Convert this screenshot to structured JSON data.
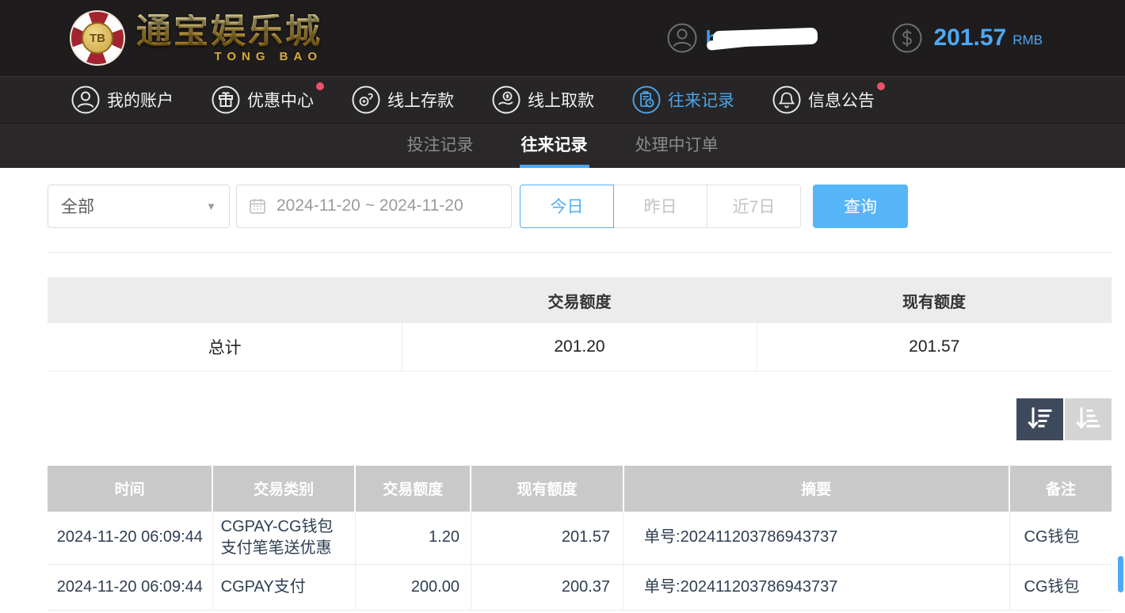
{
  "header": {
    "logo": {
      "chip_text": "TB",
      "title": "通宝娱乐城",
      "subtitle": "TONG BAO"
    },
    "balance": {
      "amount": "201.57",
      "currency": "RMB"
    }
  },
  "nav": {
    "items": [
      {
        "label": "我的账户",
        "icon": "user-circle-icon",
        "active": false,
        "badge": false
      },
      {
        "label": "优惠中心",
        "icon": "gift-icon",
        "active": false,
        "badge": true
      },
      {
        "label": "线上存款",
        "icon": "deposit-hand-coin-icon",
        "active": false,
        "badge": false
      },
      {
        "label": "线上取款",
        "icon": "withdraw-hand-coin-icon",
        "active": false,
        "badge": false
      },
      {
        "label": "往来记录",
        "icon": "records-clipboard-icon",
        "active": true,
        "badge": false
      },
      {
        "label": "信息公告",
        "icon": "bell-icon",
        "active": false,
        "badge": true
      }
    ]
  },
  "tabs": {
    "items": [
      {
        "label": "投注记录",
        "active": false
      },
      {
        "label": "往来记录",
        "active": true
      },
      {
        "label": "处理中订单",
        "active": false
      }
    ]
  },
  "filters": {
    "type_select": {
      "value": "全部"
    },
    "date_range": {
      "value": "2024-11-20 ~ 2024-11-20"
    },
    "quick_ranges": {
      "today": "今日",
      "yesterday": "昨日",
      "last7": "近7日"
    },
    "query_label": "查询"
  },
  "summary": {
    "columns": {
      "c1": "",
      "c2": "交易额度",
      "c3": "现有额度"
    },
    "total_row": {
      "label": "总计",
      "transaction_amount": "201.20",
      "current_balance": "201.57"
    }
  },
  "table": {
    "columns": {
      "time": "时间",
      "type": "交易类别",
      "amount": "交易额度",
      "balance": "现有额度",
      "summary": "摘要",
      "remark": "备注"
    },
    "rows": [
      {
        "time": "2024-11-20 06:09:44",
        "type": "CGPAY-CG钱包支付笔笔送优惠",
        "amount": "1.20",
        "balance": "201.57",
        "summary": "单号:202411203786943737",
        "remark": "CG钱包"
      },
      {
        "time": "2024-11-20 06:09:44",
        "type": "CGPAY支付",
        "amount": "200.00",
        "balance": "200.37",
        "summary": "单号:202411203786943737",
        "remark": "CG钱包"
      }
    ]
  },
  "colors": {
    "accent_blue": "#4da9f5",
    "query_button": "#55b5f7",
    "badge_red": "#f0506a",
    "table_header_gray": "#c9c9c9",
    "sort_active": "#3d4a5c",
    "topbar_dark": "#1e1c1c",
    "table_text": "#2f3e51",
    "logo_gold": "#e3b84d"
  }
}
